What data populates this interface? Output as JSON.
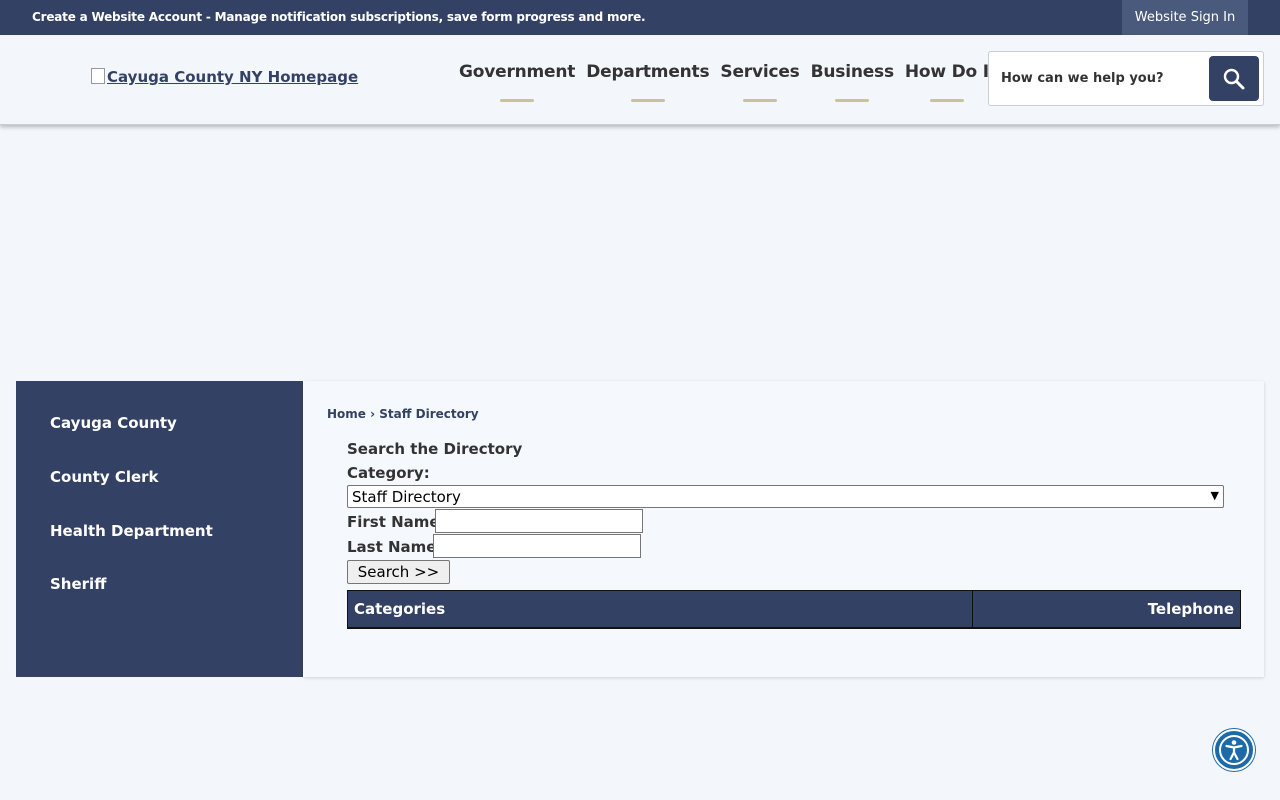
{
  "topbar": {
    "account_link": "Create a Website Account - Manage notification subscriptions, save form progress and more.",
    "sign_in": "Website Sign In"
  },
  "header": {
    "logo_alt": "Cayuga County NY Homepage",
    "nav": [
      {
        "label": "Government"
      },
      {
        "label": "Departments"
      },
      {
        "label": "Services"
      },
      {
        "label": "Business"
      },
      {
        "label": "How Do I"
      }
    ],
    "search_placeholder": "How can we help you?",
    "search_icon": "magnifier-icon"
  },
  "sidebar": {
    "items": [
      {
        "label": "Cayuga County"
      },
      {
        "label": "County Clerk"
      },
      {
        "label": "Health Department"
      },
      {
        "label": "Sheriff"
      }
    ]
  },
  "content": {
    "breadcrumb": {
      "home": "Home",
      "separator": "›",
      "current": "Staff Directory"
    },
    "title": "Search the Directory",
    "category_label": "Category:",
    "category_value": "Staff Directory",
    "first_name_label": "First Name:",
    "last_name_label": "Last Name:",
    "search_button": "Search >>",
    "table": {
      "col1": "Categories",
      "col2": "Telephone"
    }
  },
  "colors": {
    "primary": "#334264",
    "accent": "#c8c39a",
    "accessibility": "#1e6aa8"
  }
}
